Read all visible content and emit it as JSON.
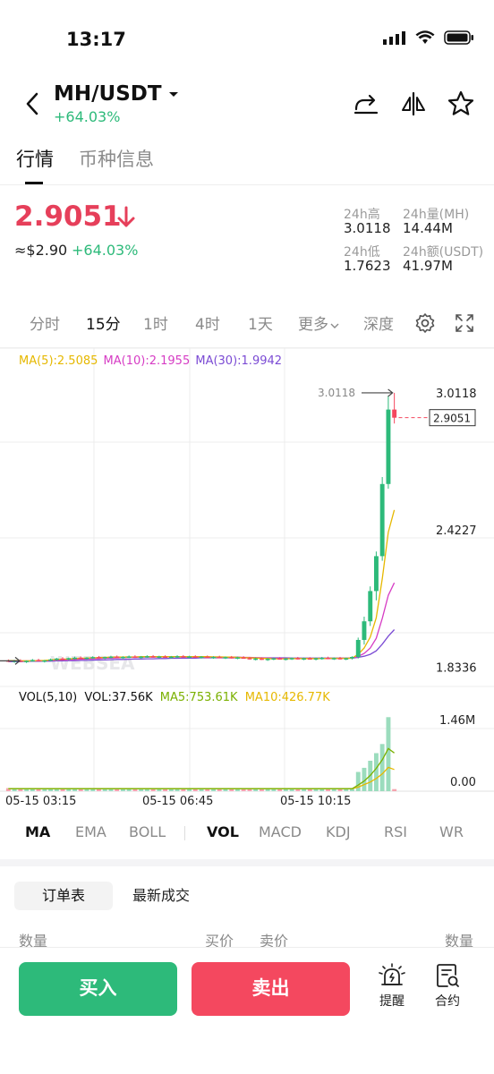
{
  "status": {
    "time": "13:17"
  },
  "header": {
    "pair": "MH/USDT",
    "change": "+64.03%"
  },
  "tabs": [
    {
      "label": "行情"
    },
    {
      "label": "币种信息"
    }
  ],
  "ticker": {
    "price": "2.9051",
    "usd": "≈$2.90",
    "change": "+64.03%",
    "high_label": "24h高",
    "high": "3.0118",
    "vol_label": "24h量(MH)",
    "vol": "14.44M",
    "low_label": "24h低",
    "low": "1.7623",
    "amt_label": "24h额(USDT)",
    "amt": "41.97M"
  },
  "timeframes": {
    "t1": "分时",
    "t2": "15分",
    "t3": "1时",
    "t4": "4时",
    "t5": "1天",
    "more": "更多",
    "depth": "深度"
  },
  "chart_labels": {
    "ma5": "MA(5):2.5085",
    "ma10": "MA(10):2.1955",
    "ma30": "MA(30):1.9942",
    "vol": "VOL(5,10)",
    "vol_val": "VOL:37.56K",
    "vma5": "MA5:753.61K",
    "vma10": "MA10:426.77K",
    "watermark": "WEBSEA"
  },
  "chart_data": {
    "type": "candlestick",
    "price_axis_ticks": [
      "3.0118",
      "2.4227",
      "1.8336"
    ],
    "current_price_tag": "2.9051",
    "high_marker": "3.0118",
    "volume_axis_ticks": [
      "1.46M",
      "0.00"
    ],
    "x_ticks": [
      "05-15 03:15",
      "05-15 06:45",
      "05-15 10:15"
    ],
    "ylim": [
      1.75,
      3.05
    ],
    "candles": [
      {
        "o": 1.862,
        "h": 1.866,
        "l": 1.855,
        "c": 1.858
      },
      {
        "o": 1.858,
        "h": 1.864,
        "l": 1.852,
        "c": 1.861
      },
      {
        "o": 1.861,
        "h": 1.867,
        "l": 1.855,
        "c": 1.857
      },
      {
        "o": 1.857,
        "h": 1.862,
        "l": 1.851,
        "c": 1.86
      },
      {
        "o": 1.86,
        "h": 1.868,
        "l": 1.856,
        "c": 1.864
      },
      {
        "o": 1.864,
        "h": 1.869,
        "l": 1.858,
        "c": 1.859
      },
      {
        "o": 1.859,
        "h": 1.864,
        "l": 1.853,
        "c": 1.862
      },
      {
        "o": 1.862,
        "h": 1.87,
        "l": 1.858,
        "c": 1.866
      },
      {
        "o": 1.866,
        "h": 1.873,
        "l": 1.861,
        "c": 1.87
      },
      {
        "o": 1.87,
        "h": 1.876,
        "l": 1.864,
        "c": 1.868
      },
      {
        "o": 1.868,
        "h": 1.874,
        "l": 1.862,
        "c": 1.872
      },
      {
        "o": 1.872,
        "h": 1.878,
        "l": 1.866,
        "c": 1.874
      },
      {
        "o": 1.874,
        "h": 1.879,
        "l": 1.868,
        "c": 1.871
      },
      {
        "o": 1.871,
        "h": 1.876,
        "l": 1.865,
        "c": 1.874
      },
      {
        "o": 1.874,
        "h": 1.88,
        "l": 1.869,
        "c": 1.876
      },
      {
        "o": 1.876,
        "h": 1.881,
        "l": 1.87,
        "c": 1.873
      },
      {
        "o": 1.873,
        "h": 1.878,
        "l": 1.867,
        "c": 1.876
      },
      {
        "o": 1.876,
        "h": 1.882,
        "l": 1.871,
        "c": 1.878
      },
      {
        "o": 1.878,
        "h": 1.883,
        "l": 1.872,
        "c": 1.875
      },
      {
        "o": 1.875,
        "h": 1.88,
        "l": 1.869,
        "c": 1.877
      },
      {
        "o": 1.877,
        "h": 1.883,
        "l": 1.872,
        "c": 1.879
      },
      {
        "o": 1.879,
        "h": 1.884,
        "l": 1.873,
        "c": 1.876
      },
      {
        "o": 1.876,
        "h": 1.881,
        "l": 1.87,
        "c": 1.878
      },
      {
        "o": 1.878,
        "h": 1.884,
        "l": 1.873,
        "c": 1.88
      },
      {
        "o": 1.88,
        "h": 1.885,
        "l": 1.874,
        "c": 1.877
      },
      {
        "o": 1.877,
        "h": 1.882,
        "l": 1.871,
        "c": 1.879
      },
      {
        "o": 1.879,
        "h": 1.884,
        "l": 1.873,
        "c": 1.876
      },
      {
        "o": 1.876,
        "h": 1.881,
        "l": 1.87,
        "c": 1.878
      },
      {
        "o": 1.878,
        "h": 1.884,
        "l": 1.873,
        "c": 1.88
      },
      {
        "o": 1.88,
        "h": 1.885,
        "l": 1.874,
        "c": 1.877
      },
      {
        "o": 1.877,
        "h": 1.882,
        "l": 1.871,
        "c": 1.879
      },
      {
        "o": 1.879,
        "h": 1.884,
        "l": 1.873,
        "c": 1.876
      },
      {
        "o": 1.876,
        "h": 1.881,
        "l": 1.87,
        "c": 1.878
      },
      {
        "o": 1.878,
        "h": 1.883,
        "l": 1.872,
        "c": 1.875
      },
      {
        "o": 1.875,
        "h": 1.88,
        "l": 1.869,
        "c": 1.877
      },
      {
        "o": 1.877,
        "h": 1.882,
        "l": 1.871,
        "c": 1.874
      },
      {
        "o": 1.874,
        "h": 1.879,
        "l": 1.868,
        "c": 1.876
      },
      {
        "o": 1.876,
        "h": 1.881,
        "l": 1.87,
        "c": 1.873
      },
      {
        "o": 1.873,
        "h": 1.878,
        "l": 1.867,
        "c": 1.875
      },
      {
        "o": 1.875,
        "h": 1.88,
        "l": 1.869,
        "c": 1.872
      },
      {
        "o": 1.872,
        "h": 1.877,
        "l": 1.866,
        "c": 1.868
      },
      {
        "o": 1.868,
        "h": 1.874,
        "l": 1.862,
        "c": 1.87
      },
      {
        "o": 1.87,
        "h": 1.875,
        "l": 1.864,
        "c": 1.866
      },
      {
        "o": 1.866,
        "h": 1.872,
        "l": 1.86,
        "c": 1.869
      },
      {
        "o": 1.869,
        "h": 1.874,
        "l": 1.863,
        "c": 1.871
      },
      {
        "o": 1.871,
        "h": 1.876,
        "l": 1.865,
        "c": 1.868
      },
      {
        "o": 1.868,
        "h": 1.873,
        "l": 1.862,
        "c": 1.87
      },
      {
        "o": 1.87,
        "h": 1.875,
        "l": 1.864,
        "c": 1.872
      },
      {
        "o": 1.872,
        "h": 1.877,
        "l": 1.866,
        "c": 1.869
      },
      {
        "o": 1.869,
        "h": 1.874,
        "l": 1.863,
        "c": 1.871
      },
      {
        "o": 1.871,
        "h": 1.876,
        "l": 1.865,
        "c": 1.868
      },
      {
        "o": 1.868,
        "h": 1.874,
        "l": 1.862,
        "c": 1.871
      },
      {
        "o": 1.871,
        "h": 1.877,
        "l": 1.865,
        "c": 1.873
      },
      {
        "o": 1.873,
        "h": 1.878,
        "l": 1.867,
        "c": 1.87
      },
      {
        "o": 1.87,
        "h": 1.875,
        "l": 1.864,
        "c": 1.872
      },
      {
        "o": 1.872,
        "h": 1.877,
        "l": 1.866,
        "c": 1.869
      },
      {
        "o": 1.869,
        "h": 1.874,
        "l": 1.863,
        "c": 1.871
      },
      {
        "o": 1.871,
        "h": 1.88,
        "l": 1.866,
        "c": 1.877
      },
      {
        "o": 1.877,
        "h": 1.96,
        "l": 1.87,
        "c": 1.95
      },
      {
        "o": 1.95,
        "h": 2.05,
        "l": 1.93,
        "c": 2.03
      },
      {
        "o": 2.03,
        "h": 2.18,
        "l": 2.01,
        "c": 2.16
      },
      {
        "o": 2.16,
        "h": 2.33,
        "l": 2.12,
        "c": 2.31
      },
      {
        "o": 2.31,
        "h": 2.65,
        "l": 2.29,
        "c": 2.62
      },
      {
        "o": 2.62,
        "h": 3.0,
        "l": 2.6,
        "c": 2.94
      },
      {
        "o": 2.94,
        "h": 3.0118,
        "l": 2.88,
        "c": 2.9051
      }
    ],
    "ma5": [
      1.861,
      1.861,
      1.86,
      1.86,
      1.86,
      1.861,
      1.862,
      1.864,
      1.866,
      1.867,
      1.868,
      1.87,
      1.871,
      1.872,
      1.873,
      1.874,
      1.875,
      1.876,
      1.876,
      1.876,
      1.877,
      1.877,
      1.878,
      1.878,
      1.878,
      1.878,
      1.878,
      1.878,
      1.878,
      1.878,
      1.878,
      1.878,
      1.878,
      1.878,
      1.877,
      1.877,
      1.876,
      1.876,
      1.875,
      1.874,
      1.873,
      1.872,
      1.871,
      1.87,
      1.869,
      1.869,
      1.869,
      1.87,
      1.87,
      1.87,
      1.87,
      1.87,
      1.87,
      1.871,
      1.871,
      1.871,
      1.871,
      1.872,
      1.888,
      1.915,
      1.962,
      2.045,
      2.214,
      2.413,
      2.5085
    ],
    "ma10": [
      1.86,
      1.86,
      1.86,
      1.86,
      1.86,
      1.86,
      1.861,
      1.862,
      1.863,
      1.864,
      1.865,
      1.866,
      1.867,
      1.868,
      1.869,
      1.87,
      1.871,
      1.872,
      1.873,
      1.874,
      1.875,
      1.875,
      1.876,
      1.876,
      1.876,
      1.877,
      1.877,
      1.877,
      1.877,
      1.877,
      1.877,
      1.877,
      1.877,
      1.877,
      1.877,
      1.877,
      1.876,
      1.876,
      1.876,
      1.875,
      1.875,
      1.874,
      1.873,
      1.872,
      1.871,
      1.871,
      1.87,
      1.87,
      1.87,
      1.87,
      1.87,
      1.87,
      1.87,
      1.87,
      1.87,
      1.871,
      1.871,
      1.871,
      1.879,
      1.892,
      1.915,
      1.957,
      2.043,
      2.142,
      2.1955
    ],
    "ma30": [
      1.857,
      1.857,
      1.857,
      1.858,
      1.858,
      1.858,
      1.859,
      1.859,
      1.86,
      1.86,
      1.861,
      1.861,
      1.862,
      1.862,
      1.863,
      1.864,
      1.864,
      1.865,
      1.866,
      1.866,
      1.867,
      1.868,
      1.868,
      1.869,
      1.869,
      1.87,
      1.87,
      1.871,
      1.871,
      1.872,
      1.872,
      1.872,
      1.873,
      1.873,
      1.873,
      1.873,
      1.873,
      1.873,
      1.873,
      1.873,
      1.873,
      1.873,
      1.873,
      1.873,
      1.873,
      1.873,
      1.873,
      1.872,
      1.872,
      1.872,
      1.872,
      1.872,
      1.872,
      1.872,
      1.872,
      1.872,
      1.872,
      1.872,
      1.875,
      1.88,
      1.888,
      1.903,
      1.932,
      1.966,
      1.9942
    ],
    "volumes": [
      0.06,
      0.05,
      0.05,
      0.04,
      0.06,
      0.05,
      0.04,
      0.05,
      0.06,
      0.05,
      0.04,
      0.05,
      0.04,
      0.05,
      0.06,
      0.05,
      0.04,
      0.05,
      0.05,
      0.04,
      0.06,
      0.05,
      0.04,
      0.05,
      0.06,
      0.05,
      0.04,
      0.05,
      0.05,
      0.04,
      0.06,
      0.05,
      0.04,
      0.05,
      0.05,
      0.04,
      0.06,
      0.05,
      0.04,
      0.05,
      0.06,
      0.05,
      0.04,
      0.05,
      0.05,
      0.04,
      0.06,
      0.05,
      0.04,
      0.05,
      0.06,
      0.05,
      0.04,
      0.05,
      0.05,
      0.04,
      0.06,
      0.05,
      0.38,
      0.46,
      0.6,
      0.75,
      0.93,
      1.46,
      0.04
    ],
    "vma5": [
      0.05,
      0.05,
      0.05,
      0.05,
      0.05,
      0.05,
      0.05,
      0.05,
      0.05,
      0.05,
      0.05,
      0.05,
      0.05,
      0.05,
      0.05,
      0.05,
      0.05,
      0.05,
      0.05,
      0.05,
      0.05,
      0.05,
      0.05,
      0.05,
      0.05,
      0.05,
      0.05,
      0.05,
      0.05,
      0.05,
      0.05,
      0.05,
      0.05,
      0.05,
      0.05,
      0.05,
      0.05,
      0.05,
      0.05,
      0.05,
      0.05,
      0.05,
      0.05,
      0.05,
      0.05,
      0.05,
      0.05,
      0.05,
      0.05,
      0.05,
      0.05,
      0.05,
      0.05,
      0.05,
      0.05,
      0.05,
      0.05,
      0.05,
      0.12,
      0.2,
      0.31,
      0.45,
      0.62,
      0.84,
      0.75361
    ],
    "vma10": [
      0.05,
      0.05,
      0.05,
      0.05,
      0.05,
      0.05,
      0.05,
      0.05,
      0.05,
      0.05,
      0.05,
      0.05,
      0.05,
      0.05,
      0.05,
      0.05,
      0.05,
      0.05,
      0.05,
      0.05,
      0.05,
      0.05,
      0.05,
      0.05,
      0.05,
      0.05,
      0.05,
      0.05,
      0.05,
      0.05,
      0.05,
      0.05,
      0.05,
      0.05,
      0.05,
      0.05,
      0.05,
      0.05,
      0.05,
      0.05,
      0.05,
      0.05,
      0.05,
      0.05,
      0.05,
      0.05,
      0.05,
      0.05,
      0.05,
      0.05,
      0.05,
      0.05,
      0.05,
      0.05,
      0.05,
      0.05,
      0.05,
      0.05,
      0.08,
      0.13,
      0.18,
      0.25,
      0.34,
      0.47,
      0.42677
    ],
    "vol_max": 1.5
  },
  "indicators": {
    "main": [
      "MA",
      "EMA",
      "BOLL"
    ],
    "sub": [
      "VOL",
      "MACD",
      "KDJ",
      "RSI",
      "WR"
    ]
  },
  "orderbook": {
    "tab_active": "订单表",
    "tab_inactive": "最新成交",
    "col_qty_left": "数量",
    "col_bid": "买价",
    "col_ask": "卖价",
    "col_qty_right": "数量"
  },
  "actions": {
    "buy": "买入",
    "sell": "卖出",
    "alert": "提醒",
    "contract": "合约"
  },
  "colors": {
    "up": "#2dba7a",
    "down": "#f4485f",
    "ma5": "#e6b800",
    "ma10": "#d63cc4",
    "ma30": "#7b4bd4"
  }
}
